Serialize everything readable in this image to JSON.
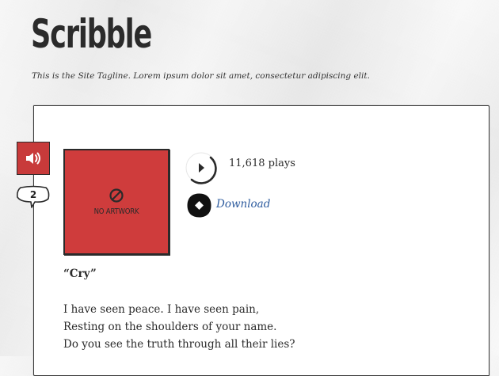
{
  "site": {
    "title": "Scribble",
    "tagline": "This is the Site Tagline. Lorem ipsum dolor sit amet, consectetur adipiscing elit."
  },
  "post": {
    "format_icon": "speaker-icon",
    "comment_count": "2",
    "artwork_label": "NO ARTWORK",
    "plays": "11,618 plays",
    "download_label": "Download",
    "title": "“Cry”",
    "lyrics": [
      "I have seen peace. I have seen pain,",
      "Resting on the shoulders of your name.",
      "Do you see the truth through all their lies?"
    ]
  },
  "colors": {
    "accent_red": "#cf3c3c",
    "link_blue": "#2d5b9e",
    "ink": "#2b2b2b"
  }
}
